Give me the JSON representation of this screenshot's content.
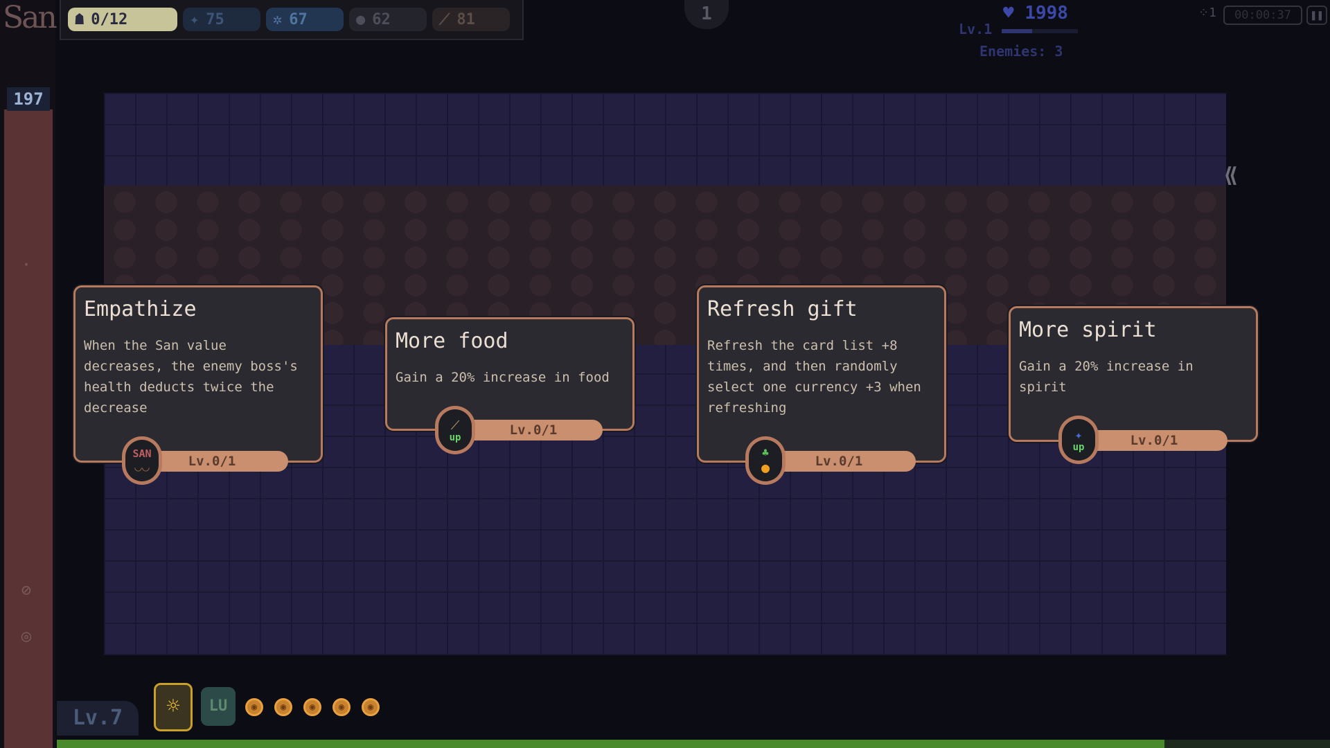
{
  "san": {
    "label": "San",
    "value": "197"
  },
  "resources": {
    "people": {
      "icon": "crowd-icon",
      "value": "0/12"
    },
    "spirit": {
      "icon": "spirit-icon",
      "value": "75"
    },
    "gear": {
      "icon": "gear-icon",
      "value": "67"
    },
    "dark": {
      "icon": "dark-orb-icon",
      "value": "62"
    },
    "food": {
      "icon": "drumstick-icon",
      "value": "81"
    }
  },
  "wave": "1",
  "player": {
    "hp": "1998",
    "level": "Lv.1",
    "enemies": "Enemies: 3",
    "xp_progress": 0.4
  },
  "timer": "00:00:37",
  "speed": "1",
  "cards": [
    {
      "title": "Empathize",
      "desc": "When the San value decreases, the enemy boss's health deducts twice the decrease",
      "level": "Lv.0/1",
      "icon_text": "SAN"
    },
    {
      "title": "More food",
      "desc": "Gain a 20% increase in food",
      "level": "Lv.0/1",
      "icon_badge": "up"
    },
    {
      "title": "Refresh gift",
      "desc": "Refresh the card list +8 times, and then randomly select one currency +3 when refreshing",
      "level": "Lv.0/1"
    },
    {
      "title": "More spirit",
      "desc": "Gain a 20% increase in spirit",
      "level": "Lv.0/1",
      "icon_badge": "up"
    }
  ],
  "bottom": {
    "level": "Lv.7",
    "lu_label": "LU",
    "coins": 5,
    "xp_progress": 0.87
  },
  "colors": {
    "card_border": "#b87a5e",
    "san_bar": "#5a3434",
    "xp_green": "#4a8a2c"
  }
}
